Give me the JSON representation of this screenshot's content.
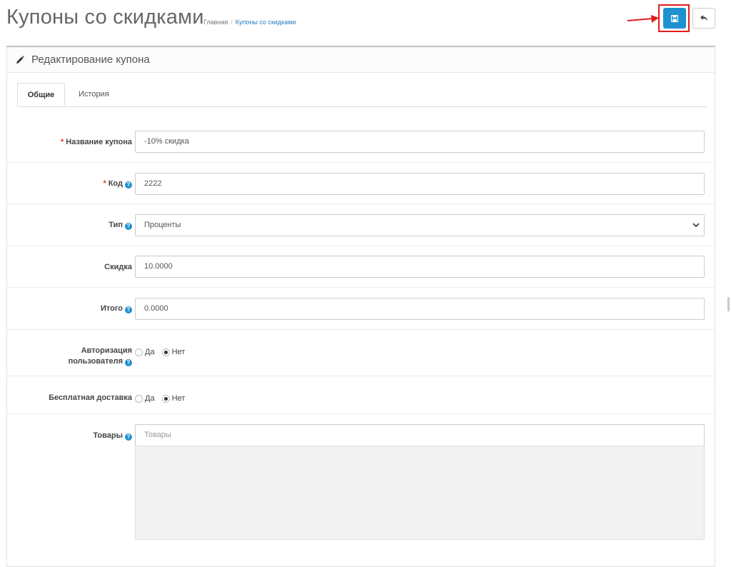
{
  "header": {
    "title": "Купоны со скидками",
    "breadcrumb": [
      "Главная",
      "Купоны со скидками"
    ]
  },
  "panel": {
    "heading": "Редактирование купона",
    "tabs": [
      {
        "label": "Общие",
        "active": true
      },
      {
        "label": "История",
        "active": false
      }
    ]
  },
  "form": {
    "name": {
      "label": "Название купона",
      "required": true,
      "value": "-10% скидка"
    },
    "code": {
      "label": "Код",
      "required": true,
      "help": true,
      "value": "2222"
    },
    "type": {
      "label": "Тип",
      "help": true,
      "value": "Проценты"
    },
    "discount": {
      "label": "Скидка",
      "value": "10.0000"
    },
    "total": {
      "label": "Итого",
      "help": true,
      "value": "0.0000"
    },
    "logged": {
      "label_line1": "Авторизация",
      "label_line2": "пользователя",
      "help": true,
      "options": [
        "Да",
        "Нет"
      ],
      "selected": "Нет"
    },
    "shipping": {
      "label": "Бесплатная доставка",
      "options": [
        "Да",
        "Нет"
      ],
      "selected": "Нет"
    },
    "products": {
      "label": "Товары",
      "help": true,
      "placeholder": "Товары"
    }
  },
  "colors": {
    "primary": "#1e91cf",
    "highlight": "#e21b1b",
    "required": "#e2342b"
  },
  "icons": {
    "save": "save-icon",
    "back": "reply-icon",
    "edit": "pencil-icon",
    "help": "question-circle-icon"
  }
}
